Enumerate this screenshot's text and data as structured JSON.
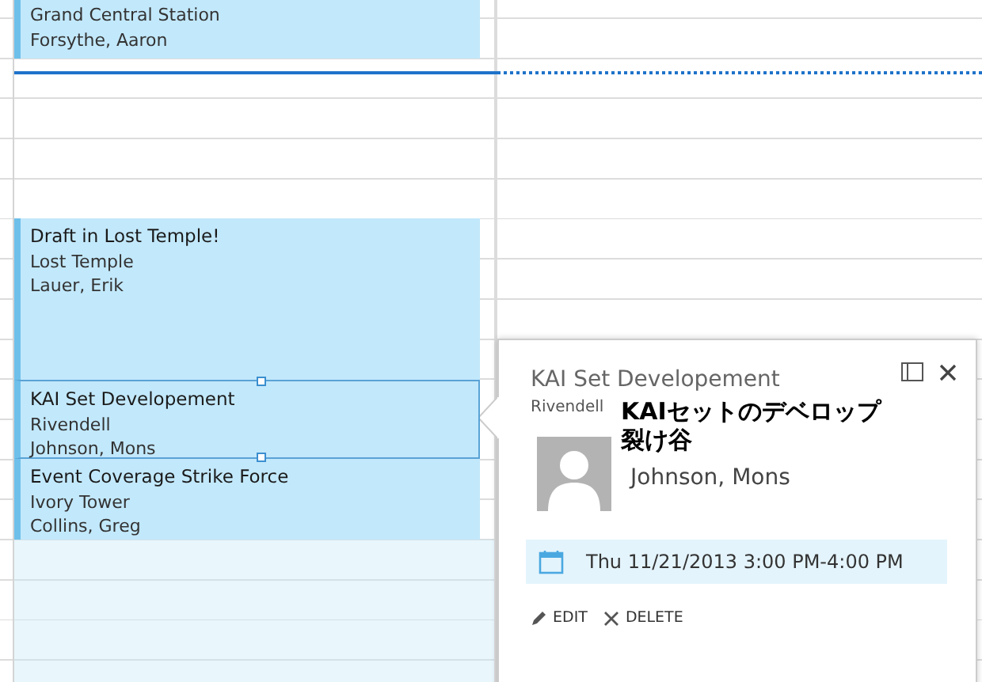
{
  "events": [
    {
      "location": "Grand Central Station",
      "organizer": "Forsythe, Aaron",
      "selected": false
    },
    {
      "title": "Draft in Lost Temple!",
      "location": "Lost Temple",
      "organizer": "Lauer, Erik",
      "selected": false
    },
    {
      "title": "KAI Set Developement",
      "location": "Rivendell",
      "organizer": "Johnson, Mons",
      "selected": true
    },
    {
      "title": "Event Coverage Strike Force",
      "location": "Ivory Tower",
      "organizer": "Collins, Greg",
      "selected": false
    }
  ],
  "popup": {
    "title": "KAI Set Developement",
    "location": "Rivendell",
    "annotation": [
      "KAIセットのデベロップ",
      "裂け谷"
    ],
    "organizer": "Johnson, Mons",
    "when": "Thu 11/21/2013 3:00 PM-4:00 PM",
    "actions": [
      "EDIT",
      "DELETE"
    ]
  }
}
